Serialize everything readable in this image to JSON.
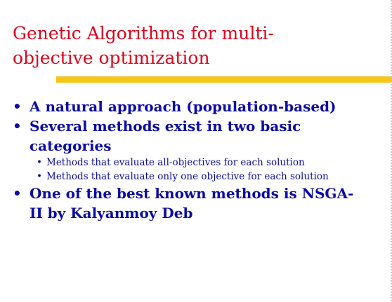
{
  "slide": {
    "title_line1": "Genetic Algorithms for multi-",
    "title_line2": "objective optimization",
    "bullets": [
      {
        "lines": [
          "A natural approach (population-based)"
        ]
      },
      {
        "lines": [
          "Several methods exist in two basic",
          "categories"
        ],
        "sub": [
          "Methods that evaluate all-objectives for each solution",
          "Methods that evaluate only one objective for each solution"
        ]
      },
      {
        "lines": [
          "One of the best known methods is NSGA-",
          "II by Kalyanmoy Deb"
        ]
      }
    ],
    "bullet_glyph": "•"
  },
  "colors": {
    "title": "#e0001b",
    "body": "#0b0ba8",
    "rule": "#f5c518"
  }
}
